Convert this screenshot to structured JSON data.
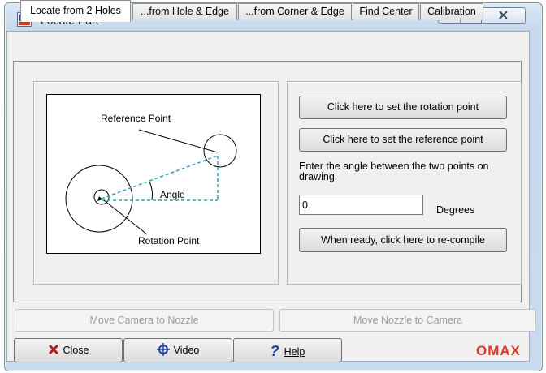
{
  "window": {
    "title": "Locate Part",
    "app_icon": "omax-app-icon"
  },
  "tabs": [
    {
      "label": "Locate from 2 Holes",
      "active": true
    },
    {
      "label": "...from Hole & Edge",
      "active": false
    },
    {
      "label": "...from Corner & Edge",
      "active": false
    },
    {
      "label": "Find Center",
      "active": false
    },
    {
      "label": "Calibration",
      "active": false
    }
  ],
  "diagram": {
    "reference_point": "Reference Point",
    "angle": "Angle",
    "rotation_point": "Rotation Point"
  },
  "controls": {
    "set_rotation_button": "Click here to set the rotation point",
    "set_reference_button": "Click here to set the reference point",
    "instruction": "Enter the angle between the two points on drawing.",
    "angle_value": "0",
    "angle_unit": "Degrees",
    "recompile_button": "When ready, click here to re-compile"
  },
  "camera": {
    "move_camera_button": "Move Camera to Nozzle",
    "move_nozzle_button": "Move Nozzle to Camera",
    "enabled": false
  },
  "footer": {
    "close_label": "Close",
    "video_label": "Video",
    "help_label": "Help",
    "brand": "OMAX"
  },
  "colors": {
    "brand": "#d73a22",
    "dashed_line": "#2aa3b5",
    "close_x": "#b01e1e",
    "help_q": "#1f3d9c"
  }
}
